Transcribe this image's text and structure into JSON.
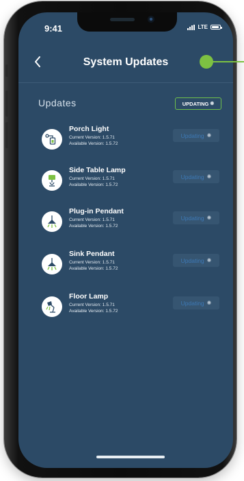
{
  "status_bar": {
    "time": "9:41",
    "network": "LTE"
  },
  "header": {
    "back_icon": "chevron-left-icon",
    "title": "System Updates"
  },
  "updates": {
    "heading": "Updates",
    "updating_all_label": "UPDATING"
  },
  "devices": [
    {
      "name": "Porch Light",
      "current": "Current Version: 1.5.71",
      "available": "Available Version: 1.5.72",
      "button": "Updating",
      "icon": "porch-light-icon"
    },
    {
      "name": "Side Table Lamp",
      "current": "Current Version: 1.5.71",
      "available": "Available Version: 1.5.72",
      "button": "Updating",
      "icon": "table-lamp-icon"
    },
    {
      "name": "Plug-in Pendant",
      "current": "Current Version: 1.5.71",
      "available": "Available Version: 1.5.72",
      "button": "Updating",
      "icon": "pendant-icon"
    },
    {
      "name": "Sink Pendant",
      "current": "Current Version: 1.5.71",
      "available": "Available Version: 1.5.72",
      "button": "Updating",
      "icon": "pendant-icon"
    },
    {
      "name": "Floor Lamp",
      "current": "Current Version: 1.5.71",
      "available": "Available Version: 1.5.72",
      "button": "Updating",
      "icon": "floor-lamp-icon"
    }
  ],
  "colors": {
    "screen_bg": "#2c4a66",
    "accent_green": "#7dc142",
    "button_text": "#3d79b6"
  }
}
